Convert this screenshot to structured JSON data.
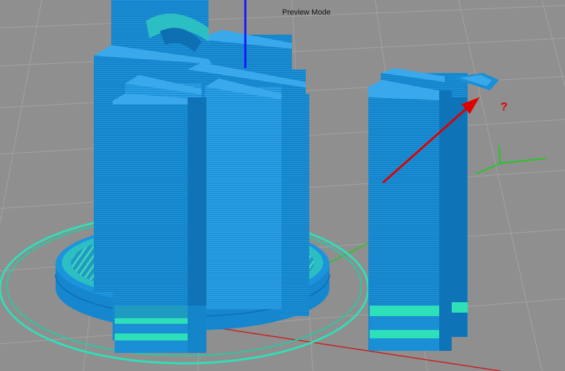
{
  "viewport": {
    "mode_label": "Preview Mode",
    "annotation_text": "?",
    "colors": {
      "background": "#8f8f8f",
      "grid": "#a2a2a2",
      "filament": "#1a8fd6",
      "filament_dark": "#0e6fb3",
      "filament_light": "#3aa9ec",
      "skirt": "#2ee0b8",
      "annotation": "#e00000",
      "axis_x": "#c81e1e",
      "axis_y": "#22c822",
      "axis_z": "#1414ff"
    }
  }
}
